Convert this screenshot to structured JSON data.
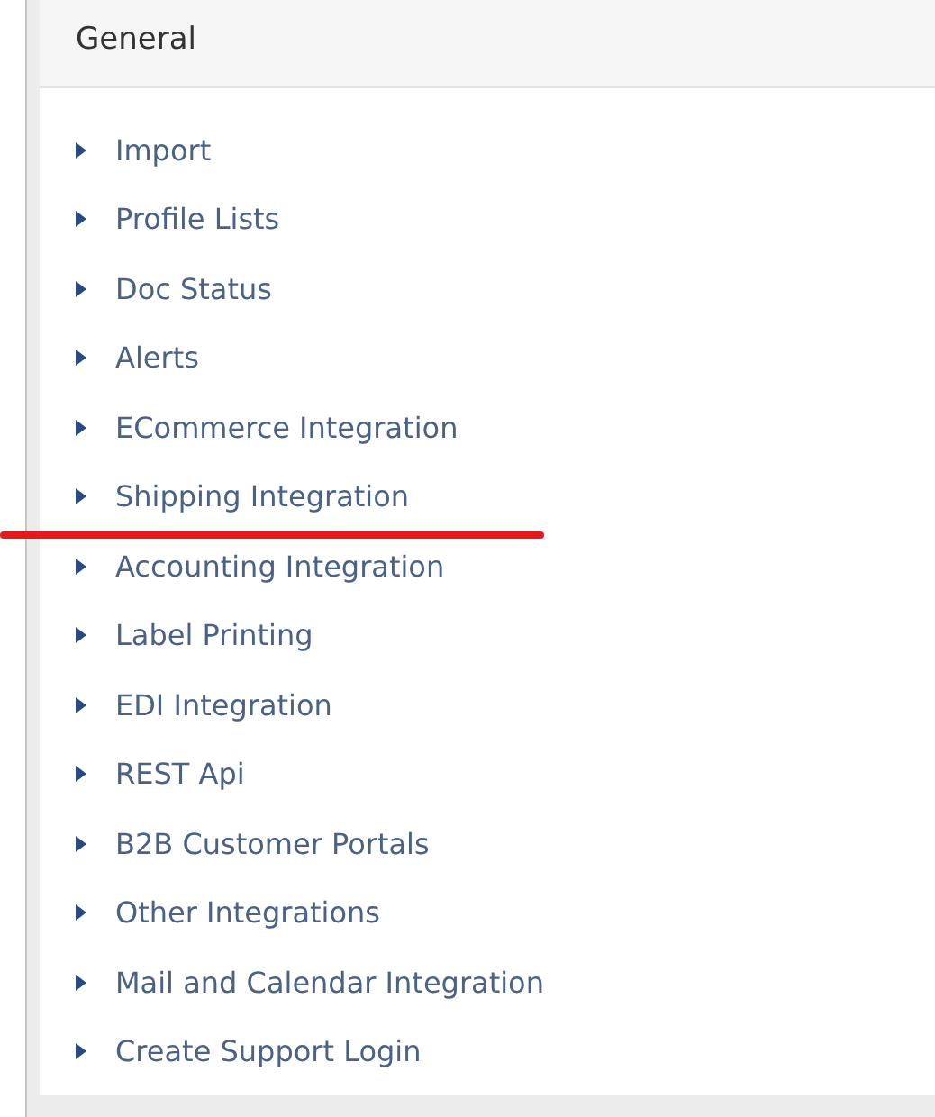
{
  "panel": {
    "title": "General",
    "items": [
      {
        "label": "Import"
      },
      {
        "label": "Profile Lists"
      },
      {
        "label": "Doc Status"
      },
      {
        "label": "Alerts"
      },
      {
        "label": "ECommerce Integration"
      },
      {
        "label": "Shipping Integration",
        "marked": true
      },
      {
        "label": "Accounting Integration"
      },
      {
        "label": "Label Printing"
      },
      {
        "label": "EDI Integration"
      },
      {
        "label": "REST Api"
      },
      {
        "label": "B2B Customer Portals"
      },
      {
        "label": "Other Integrations"
      },
      {
        "label": "Mail and Calendar Integration"
      },
      {
        "label": "Create Support Login"
      }
    ]
  }
}
